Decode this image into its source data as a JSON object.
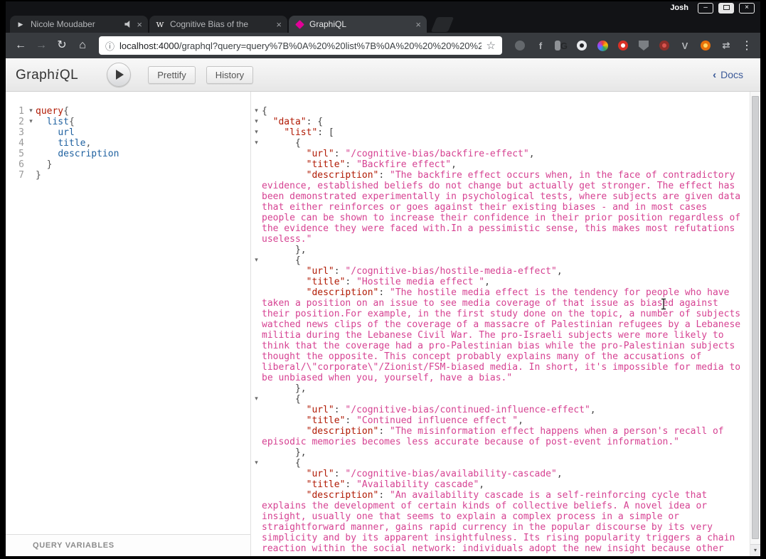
{
  "window": {
    "user_label": "Josh",
    "minimize_glyph": "–",
    "close_glyph": "×"
  },
  "browser": {
    "tabs": [
      {
        "label": "Nicole Moudaber",
        "favicon": "play",
        "favicon_glyph": "▶",
        "audio": true,
        "active": false
      },
      {
        "label": "Cognitive Bias of the",
        "favicon": "wikipedia",
        "favicon_glyph": "w",
        "audio": false,
        "active": false
      },
      {
        "label": "GraphiQL",
        "favicon": "graphiql",
        "favicon_glyph": "",
        "audio": false,
        "active": true
      }
    ],
    "tab_close_glyph": "×",
    "nav": {
      "back": "←",
      "forward": "→",
      "reload": "↻",
      "home": "⌂"
    },
    "url": {
      "host": "localhost:4000",
      "rest": "/graphql?query=query%7B%0A%20%20list%7B%0A%20%20%20%20%20url%"
    },
    "info_icon": "ⓘ",
    "star_icon": "☆",
    "menu_icon": "⋮",
    "extensions": [
      {
        "name": "clock-extension-icon",
        "shape": "circle",
        "bg": "#64686c"
      },
      {
        "name": "f-extension-icon",
        "glyph": "f",
        "fg": "#b2b5b8"
      },
      {
        "name": "g-extension-icon",
        "shape": "square",
        "bg": "#8f9296",
        "glyph": "G",
        "fg": "#26282a"
      },
      {
        "name": "lens-extension-icon",
        "shape": "circle",
        "bg": "#e8eaed",
        "dot": "#202124"
      },
      {
        "name": "color-wheel-extension-icon",
        "shape": "pinwheel"
      },
      {
        "name": "adblock-extension-icon",
        "shape": "circle",
        "bg": "#d93025",
        "dot": "#ffffff"
      },
      {
        "name": "shield-extension-icon",
        "shape": "shield",
        "bg": "#7b7f83"
      },
      {
        "name": "red-extension-icon",
        "shape": "circle",
        "bg": "#8e2f2a",
        "dot": "#d9534f"
      },
      {
        "name": "v-extension-icon",
        "glyph": "V",
        "fg": "#b2b5b8"
      },
      {
        "name": "orange-extension-icon",
        "shape": "circle",
        "bg": "#e8710a",
        "dot": "#fdd663"
      },
      {
        "name": "arrows-extension-icon",
        "glyph": "⇄",
        "fg": "#b2b5b8"
      }
    ]
  },
  "graphiql": {
    "logo": {
      "pre": "Graph",
      "i": "i",
      "post": "QL"
    },
    "toolbar": {
      "prettify": "Prettify",
      "history": "History"
    },
    "docs": {
      "chevron": "‹",
      "label": "Docs"
    },
    "query_variables_label": "QUERY VARIABLES",
    "fold_glyph": "▾",
    "scroll_down_glyph": "▾",
    "colors": {
      "keyword": "#B11A04",
      "field": "#1F61A0",
      "key": "#B11A04",
      "string": "#D64292",
      "punctuation": "#555555"
    },
    "query_editor": {
      "lines": [
        {
          "fold": true,
          "tokens": [
            [
              "query",
              "kw"
            ],
            [
              "{",
              "pun"
            ]
          ]
        },
        {
          "fold": true,
          "tokens": [
            [
              "  ",
              ""
            ],
            [
              "list",
              "field"
            ],
            [
              "{",
              "pun"
            ]
          ]
        },
        {
          "fold": false,
          "tokens": [
            [
              "    ",
              ""
            ],
            [
              "url",
              "field"
            ]
          ]
        },
        {
          "fold": false,
          "tokens": [
            [
              "    ",
              ""
            ],
            [
              "title",
              "field"
            ],
            [
              ",",
              "pun"
            ]
          ]
        },
        {
          "fold": false,
          "tokens": [
            [
              "    ",
              ""
            ],
            [
              "description",
              "field"
            ]
          ]
        },
        {
          "fold": false,
          "tokens": [
            [
              "  ",
              ""
            ],
            [
              "}",
              "pun"
            ]
          ]
        },
        {
          "fold": false,
          "tokens": [
            [
              "}",
              "pun"
            ]
          ]
        }
      ]
    },
    "result": {
      "lines": [
        {
          "fold": true,
          "tokens": [
            [
              "{",
              ""
            ]
          ]
        },
        {
          "fold": true,
          "tokens": [
            [
              "  ",
              ""
            ],
            [
              "\"data\"",
              "key"
            ],
            [
              ": {",
              ""
            ]
          ]
        },
        {
          "fold": true,
          "tokens": [
            [
              "    ",
              ""
            ],
            [
              "\"list\"",
              "key"
            ],
            [
              ": [",
              ""
            ]
          ]
        },
        {
          "fold": true,
          "tokens": [
            [
              "      {",
              ""
            ]
          ]
        },
        {
          "fold": false,
          "tokens": [
            [
              "        ",
              ""
            ],
            [
              "\"url\"",
              "key"
            ],
            [
              ": ",
              ""
            ],
            [
              "\"/cognitive-bias/backfire-effect\"",
              "str"
            ],
            [
              ",",
              ""
            ]
          ]
        },
        {
          "fold": false,
          "tokens": [
            [
              "        ",
              ""
            ],
            [
              "\"title\"",
              "key"
            ],
            [
              ": ",
              ""
            ],
            [
              "\"Backfire effect\"",
              "str"
            ],
            [
              ",",
              ""
            ]
          ]
        },
        {
          "fold": false,
          "tokens": [
            [
              "        ",
              ""
            ],
            [
              "\"description\"",
              "key"
            ],
            [
              ": ",
              ""
            ],
            [
              "\"The backfire effect occurs when, in the face of contradictory evidence, established beliefs do not change but actually get stronger. The effect has been demonstrated experimentally in psychological tests, where subjects are given data that either reinforces or goes against their existing biases - and in most cases people can be shown to increase their confidence in their prior position regardless of the evidence they were faced with.In a pessimistic sense, this makes most refutations useless.\"",
              "str"
            ]
          ]
        },
        {
          "fold": false,
          "tokens": [
            [
              "      },",
              ""
            ]
          ]
        },
        {
          "fold": true,
          "tokens": [
            [
              "      {",
              ""
            ]
          ]
        },
        {
          "fold": false,
          "tokens": [
            [
              "        ",
              ""
            ],
            [
              "\"url\"",
              "key"
            ],
            [
              ": ",
              ""
            ],
            [
              "\"/cognitive-bias/hostile-media-effect\"",
              "str"
            ],
            [
              ",",
              ""
            ]
          ]
        },
        {
          "fold": false,
          "tokens": [
            [
              "        ",
              ""
            ],
            [
              "\"title\"",
              "key"
            ],
            [
              ": ",
              ""
            ],
            [
              "\"Hostile media effect \"",
              "str"
            ],
            [
              ",",
              ""
            ]
          ]
        },
        {
          "fold": false,
          "tokens": [
            [
              "        ",
              ""
            ],
            [
              "\"description\"",
              "key"
            ],
            [
              ": ",
              ""
            ],
            [
              "\"The hostile media effect is the tendency for people who have taken a position on an issue to see media coverage of that issue as biased against their position.For example, in the first study done on the topic, a number of subjects watched news clips of the coverage of a massacre of Palestinian refugees by a Lebanese militia during the Lebanese Civil War. The pro-Israeli subjects were more likely to think that the coverage had a pro-Palestinian bias while the pro-Palestinian subjects thought the opposite. This concept probably explains many of the accusations of liberal/\\\"corporate\\\"/Zionist/FSM-biased media. In short, it's impossible for media to be unbiased when you, yourself, have a bias.\"",
              "str"
            ]
          ]
        },
        {
          "fold": false,
          "tokens": [
            [
              "      },",
              ""
            ]
          ]
        },
        {
          "fold": true,
          "tokens": [
            [
              "      {",
              ""
            ]
          ]
        },
        {
          "fold": false,
          "tokens": [
            [
              "        ",
              ""
            ],
            [
              "\"url\"",
              "key"
            ],
            [
              ": ",
              ""
            ],
            [
              "\"/cognitive-bias/continued-influence-effect\"",
              "str"
            ],
            [
              ",",
              ""
            ]
          ]
        },
        {
          "fold": false,
          "tokens": [
            [
              "        ",
              ""
            ],
            [
              "\"title\"",
              "key"
            ],
            [
              ": ",
              ""
            ],
            [
              "\"Continued influence effect \"",
              "str"
            ],
            [
              ",",
              ""
            ]
          ]
        },
        {
          "fold": false,
          "tokens": [
            [
              "        ",
              ""
            ],
            [
              "\"description\"",
              "key"
            ],
            [
              ": ",
              ""
            ],
            [
              "\"The misinformation effect happens when a person's recall of episodic memories becomes less accurate because of post-event information.\"",
              "str"
            ]
          ]
        },
        {
          "fold": false,
          "tokens": [
            [
              "      },",
              ""
            ]
          ]
        },
        {
          "fold": true,
          "tokens": [
            [
              "      {",
              ""
            ]
          ]
        },
        {
          "fold": false,
          "tokens": [
            [
              "        ",
              ""
            ],
            [
              "\"url\"",
              "key"
            ],
            [
              ": ",
              ""
            ],
            [
              "\"/cognitive-bias/availability-cascade\"",
              "str"
            ],
            [
              ",",
              ""
            ]
          ]
        },
        {
          "fold": false,
          "tokens": [
            [
              "        ",
              ""
            ],
            [
              "\"title\"",
              "key"
            ],
            [
              ": ",
              ""
            ],
            [
              "\"Availability cascade\"",
              "str"
            ],
            [
              ",",
              ""
            ]
          ]
        },
        {
          "fold": false,
          "tokens": [
            [
              "        ",
              ""
            ],
            [
              "\"description\"",
              "key"
            ],
            [
              ": ",
              ""
            ],
            [
              "\"An availability cascade is a self-reinforcing cycle that explains the development of certain kinds of collective beliefs. A novel idea or insight, usually one that seems to explain a complex process in a simple or straightforward manner, gains rapid currency in the popular discourse by its very simplicity and by its apparent insightfulness. Its rising popularity triggers a chain reaction within the social network: individuals adopt the new insight because other",
              "str"
            ]
          ]
        }
      ]
    }
  }
}
